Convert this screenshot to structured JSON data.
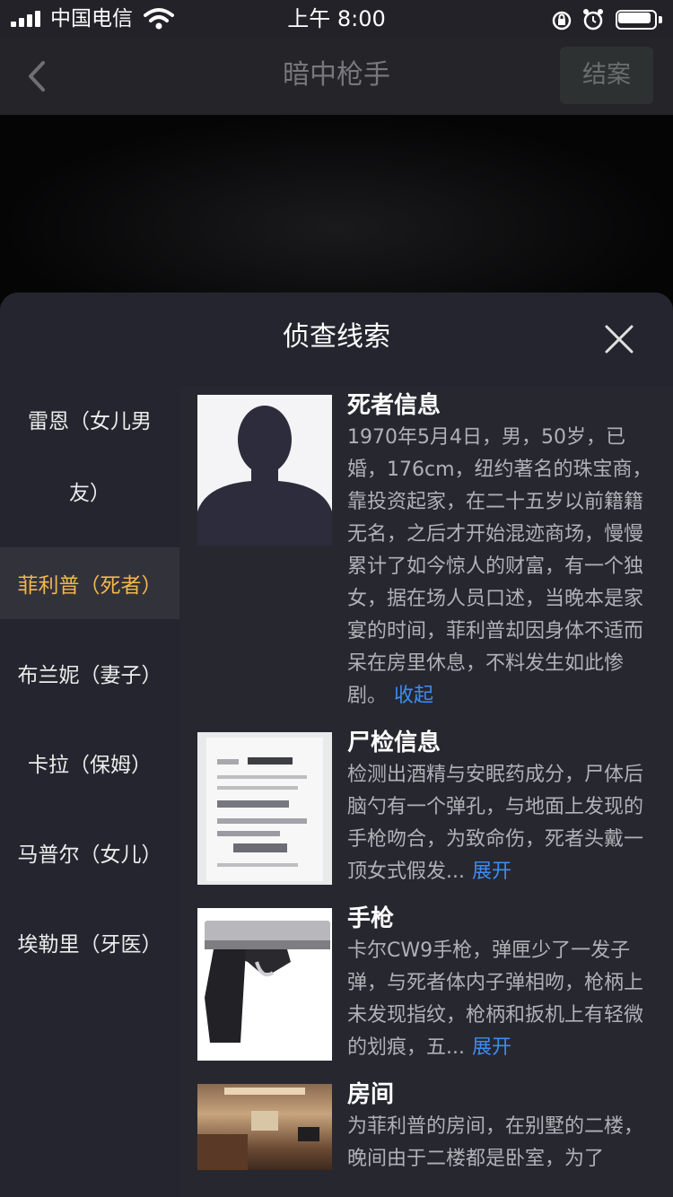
{
  "status_bar": {
    "carrier": "中国电信",
    "time": "上午 8:00"
  },
  "nav": {
    "title": "暗中枪手",
    "close_case_label": "结案"
  },
  "sheet": {
    "title": "侦查线索"
  },
  "sidebar": {
    "items": [
      {
        "label": "雷恩（女儿男友）",
        "active": false
      },
      {
        "label": "菲利普（死者）",
        "active": true
      },
      {
        "label": "布兰妮（妻子）",
        "active": false
      },
      {
        "label": "卡拉（保姆）",
        "active": false
      },
      {
        "label": "马普尔（女儿）",
        "active": false
      },
      {
        "label": "埃勒里（牙医）",
        "active": false
      }
    ]
  },
  "clues": [
    {
      "title": "死者信息",
      "text": "1970年5月4日，男，50岁，已婚，176cm，纽约著名的珠宝商，靠投资起家，在二十五岁以前籍籍无名，之后才开始混迹商场，慢慢累计了如今惊人的财富，有一个独女，据在场人员口述，当晚本是家宴的时间，菲利普却因身体不适而呆在房里休息，不料发生如此惨剧。",
      "action": "收起"
    },
    {
      "title": "尸检信息",
      "text": "检测出酒精与安眠药成分，尸体后脑勺有一个弹孔，与地面上发现的手枪吻合，为致命伤，死者头戴一顶女式假发...",
      "action": "展开"
    },
    {
      "title": "手枪",
      "text": "卡尔CW9手枪，弹匣少了一发子弹，与死者体内子弹相吻，枪柄上未发现指纹，枪柄和扳机上有轻微的划痕，五...",
      "action": "展开"
    },
    {
      "title": "房间",
      "text": "为菲利普的房间，在别墅的二楼，晚间由于二楼都是卧室，为了",
      "action": ""
    }
  ],
  "colors": {
    "accent": "#f2b84a",
    "link": "#3d8cf3",
    "sheet_bg": "#25252f"
  }
}
